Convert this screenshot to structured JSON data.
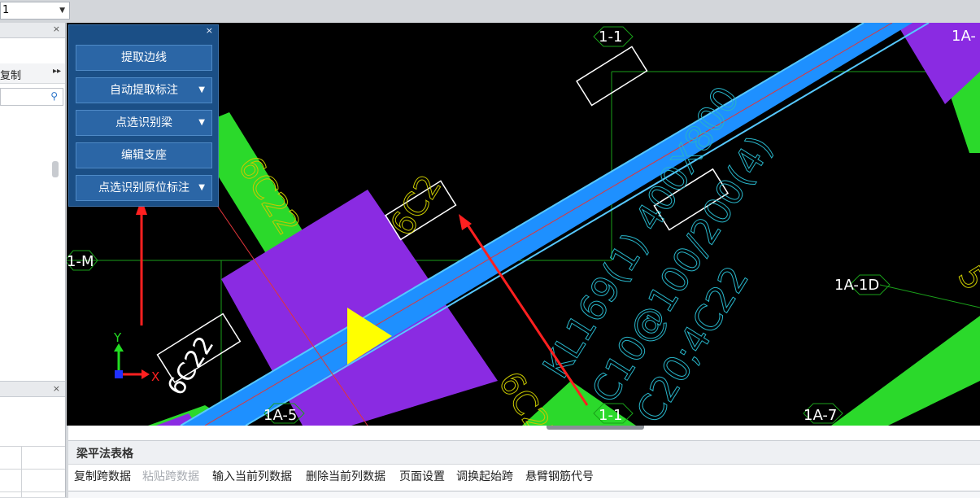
{
  "floor_select": {
    "value": "1"
  },
  "left_panel": {
    "copy_label": "复制",
    "more_glyph": "▸▸",
    "close_glyph": "×",
    "search_icon_glyph": "⚲"
  },
  "float_panel": {
    "close_glyph": "×",
    "buttons": [
      {
        "label": "提取边线",
        "has_arrow": false
      },
      {
        "label": "自动提取标注",
        "has_arrow": true
      },
      {
        "label": "点选识别梁",
        "has_arrow": true
      },
      {
        "label": "编辑支座",
        "has_arrow": false
      },
      {
        "label": "点选识别原位标注",
        "has_arrow": true
      }
    ],
    "arrow_glyph": "▼"
  },
  "cad": {
    "axis_bubbles": [
      "1-1",
      "1A-",
      "1-M",
      "1A-1D",
      "1A-5",
      "1-1",
      "1A-7"
    ],
    "rebar_labels": [
      "6C22",
      "6C22",
      "6C22",
      "6C22",
      "6C2",
      "5"
    ],
    "beam_annotation": [
      "KL169(1) 400X800",
      "C10@100/200(4)",
      "C20;4C22"
    ],
    "ucs": {
      "y": "Y",
      "x": "X"
    },
    "colors": {
      "beam": "#1e90ff",
      "column": "#8a2be2",
      "green": "#2bd92b",
      "annotation": "#c8c800",
      "cyan": "#28b4c8",
      "arrow": "#ff2020"
    }
  },
  "bottom": {
    "title": "梁平法表格",
    "toolbar": [
      {
        "label": "复制跨数据",
        "disabled": false
      },
      {
        "label": "粘贴跨数据",
        "disabled": true
      },
      {
        "label": "输入当前列数据",
        "disabled": false
      },
      {
        "label": "删除当前列数据",
        "disabled": false
      },
      {
        "label": "页面设置",
        "disabled": false
      },
      {
        "label": "调换起始跨",
        "disabled": false
      },
      {
        "label": "悬臂钢筋代号",
        "disabled": false
      }
    ]
  }
}
